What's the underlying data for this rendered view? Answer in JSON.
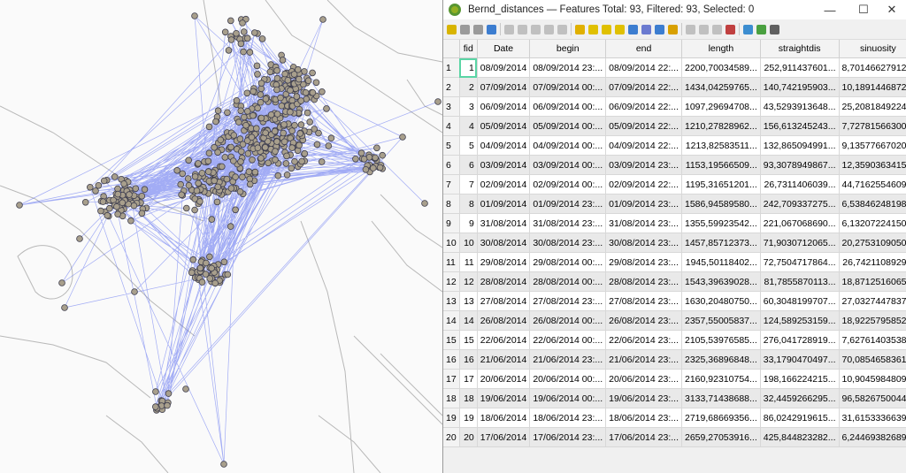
{
  "window": {
    "title": "Bernd_distances — Features Total: 93, Filtered: 93, Selected: 0",
    "minimize": "—",
    "maximize": "☐",
    "close": "✕"
  },
  "toolbar": {
    "icons": [
      "edit-pencil-icon",
      "multi-edit-icon",
      "save-edits-icon",
      "reload-icon",
      "add-feature-icon",
      "delete-feature-icon",
      "cut-icon",
      "copy-icon",
      "paste-icon",
      "select-expression-icon",
      "select-all-icon",
      "invert-selection-icon",
      "deselect-icon",
      "filter-icon",
      "move-selection-top-icon",
      "pan-to-selected-icon",
      "zoom-to-selected-icon",
      "new-field-icon",
      "delete-field-icon",
      "field-calculator-icon",
      "conditional-formatting-icon",
      "dock-icon",
      "actions-icon",
      "expand-icon"
    ]
  },
  "table": {
    "columns": [
      "fid",
      "Date",
      "begin",
      "end",
      "length",
      "straightdis",
      "sinuosity"
    ],
    "rows": [
      {
        "row": "1",
        "fid": "1",
        "date": "08/09/2014",
        "begin": "08/09/2014 23:...",
        "end": "08/09/2014 22:...",
        "length": "2200,70034589...",
        "straight": "252,911437601...",
        "sinuosity": "8,70146627912..."
      },
      {
        "row": "2",
        "fid": "2",
        "date": "07/09/2014",
        "begin": "07/09/2014 00:...",
        "end": "07/09/2014 22:...",
        "length": "1434,04259765...",
        "straight": "140,742195903...",
        "sinuosity": "10,1891446872..."
      },
      {
        "row": "3",
        "fid": "3",
        "date": "06/09/2014",
        "begin": "06/09/2014 00:...",
        "end": "06/09/2014 22:...",
        "length": "1097,29694708...",
        "straight": "43,5293913648...",
        "sinuosity": "25,2081849224..."
      },
      {
        "row": "4",
        "fid": "4",
        "date": "05/09/2014",
        "begin": "05/09/2014 00:...",
        "end": "05/09/2014 22:...",
        "length": "1210,27828962...",
        "straight": "156,613245243...",
        "sinuosity": "7,72781566300..."
      },
      {
        "row": "5",
        "fid": "5",
        "date": "04/09/2014",
        "begin": "04/09/2014 00:...",
        "end": "04/09/2014 22:...",
        "length": "1213,82583511...",
        "straight": "132,865094991...",
        "sinuosity": "9,13577667020..."
      },
      {
        "row": "6",
        "fid": "6",
        "date": "03/09/2014",
        "begin": "03/09/2014 00:...",
        "end": "03/09/2014 23:...",
        "length": "1153,19566509...",
        "straight": "93,3078949867...",
        "sinuosity": "12,3590363415..."
      },
      {
        "row": "7",
        "fid": "7",
        "date": "02/09/2014",
        "begin": "02/09/2014 00:...",
        "end": "02/09/2014 22:...",
        "length": "1195,31651201...",
        "straight": "26,7311406039...",
        "sinuosity": "44,7162554609..."
      },
      {
        "row": "8",
        "fid": "8",
        "date": "01/09/2014",
        "begin": "01/09/2014 23:...",
        "end": "01/09/2014 23:...",
        "length": "1586,94589580...",
        "straight": "242,709337275...",
        "sinuosity": "6,53846248198..."
      },
      {
        "row": "9",
        "fid": "9",
        "date": "31/08/2014",
        "begin": "31/08/2014 23:...",
        "end": "31/08/2014 23:...",
        "length": "1355,59923542...",
        "straight": "221,067068690...",
        "sinuosity": "6,13207224150..."
      },
      {
        "row": "10",
        "fid": "10",
        "date": "30/08/2014",
        "begin": "30/08/2014 23:...",
        "end": "30/08/2014 23:...",
        "length": "1457,85712373...",
        "straight": "71,9030712065...",
        "sinuosity": "20,2753109050..."
      },
      {
        "row": "11",
        "fid": "11",
        "date": "29/08/2014",
        "begin": "29/08/2014 00:...",
        "end": "29/08/2014 23:...",
        "length": "1945,50118402...",
        "straight": "72,7504717864...",
        "sinuosity": "26,7421108929..."
      },
      {
        "row": "12",
        "fid": "12",
        "date": "28/08/2014",
        "begin": "28/08/2014 00:...",
        "end": "28/08/2014 23:...",
        "length": "1543,39639028...",
        "straight": "81,7855870113...",
        "sinuosity": "18,8712516065..."
      },
      {
        "row": "13",
        "fid": "13",
        "date": "27/08/2014",
        "begin": "27/08/2014 23:...",
        "end": "27/08/2014 23:...",
        "length": "1630,20480750...",
        "straight": "60,3048199707...",
        "sinuosity": "27,0327447837..."
      },
      {
        "row": "14",
        "fid": "14",
        "date": "26/08/2014",
        "begin": "26/08/2014 00:...",
        "end": "26/08/2014 23:...",
        "length": "2357,55005837...",
        "straight": "124,589253159...",
        "sinuosity": "18,9225795852..."
      },
      {
        "row": "15",
        "fid": "15",
        "date": "22/06/2014",
        "begin": "22/06/2014 00:...",
        "end": "22/06/2014 23:...",
        "length": "2105,53976585...",
        "straight": "276,041728919...",
        "sinuosity": "7,62761403538..."
      },
      {
        "row": "16",
        "fid": "16",
        "date": "21/06/2014",
        "begin": "21/06/2014 23:...",
        "end": "21/06/2014 23:...",
        "length": "2325,36896848...",
        "straight": "33,1790470497...",
        "sinuosity": "70,0854658361..."
      },
      {
        "row": "17",
        "fid": "17",
        "date": "20/06/2014",
        "begin": "20/06/2014 00:...",
        "end": "20/06/2014 23:...",
        "length": "2160,92310754...",
        "straight": "198,166224215...",
        "sinuosity": "10,9045984809..."
      },
      {
        "row": "18",
        "fid": "18",
        "date": "19/06/2014",
        "begin": "19/06/2014 00:...",
        "end": "19/06/2014 23:...",
        "length": "3133,71438688...",
        "straight": "32,4459266295...",
        "sinuosity": "96,5826750044..."
      },
      {
        "row": "19",
        "fid": "19",
        "date": "18/06/2014",
        "begin": "18/06/2014 23:...",
        "end": "18/06/2014 23:...",
        "length": "2719,68669356...",
        "straight": "86,0242919615...",
        "sinuosity": "31,6153336639..."
      },
      {
        "row": "20",
        "fid": "20",
        "date": "17/06/2014",
        "begin": "17/06/2014 23:...",
        "end": "17/06/2014 23:...",
        "length": "2659,27053916...",
        "straight": "425,844823282...",
        "sinuosity": "6,24469382689..."
      }
    ]
  },
  "colors": {
    "point_fill": "#a89f8c",
    "point_stroke": "#3f3f4f",
    "track_line": "#5a6cf0",
    "base_line": "#b8b8b8"
  }
}
